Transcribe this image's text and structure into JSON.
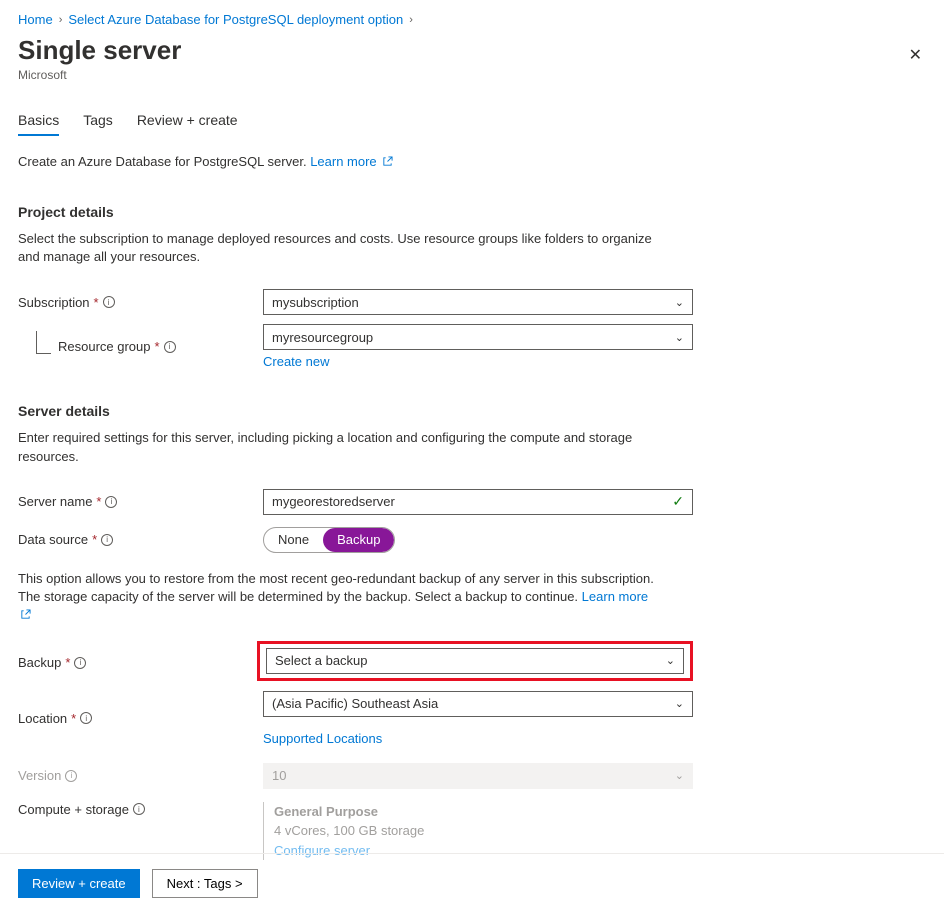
{
  "breadcrumb": {
    "home": "Home",
    "parent": "Select Azure Database for PostgreSQL deployment option"
  },
  "title": "Single server",
  "subtitle": "Microsoft",
  "tabs": {
    "basics": "Basics",
    "tags": "Tags",
    "review": "Review + create"
  },
  "intro": {
    "text": "Create an Azure Database for PostgreSQL server.",
    "learn": "Learn more"
  },
  "project": {
    "heading": "Project details",
    "desc": "Select the subscription to manage deployed resources and costs. Use resource groups like folders to organize and manage all your resources.",
    "subscription_label": "Subscription",
    "subscription_value": "mysubscription",
    "rg_label": "Resource group",
    "rg_value": "myresourcegroup",
    "create_new": "Create new"
  },
  "server": {
    "heading": "Server details",
    "desc": "Enter required settings for this server, including picking a location and configuring the compute and storage resources.",
    "name_label": "Server name",
    "name_value": "mygeorestoredserver",
    "ds_label": "Data source",
    "ds_none": "None",
    "ds_backup": "Backup",
    "restore_desc": "This option allows you to restore from the most recent geo-redundant backup of any server in this subscription. The storage capacity of the server will be determined by the backup. Select a backup to continue.",
    "learn": "Learn more",
    "backup_label": "Backup",
    "backup_value": "Select a backup",
    "location_label": "Location",
    "location_value": "(Asia Pacific) Southeast Asia",
    "supported": "Supported Locations",
    "version_label": "Version",
    "version_value": "10",
    "compute_label": "Compute + storage",
    "compute_tier": "General Purpose",
    "compute_spec": "4 vCores, 100 GB storage",
    "configure": "Configure server"
  },
  "footer": {
    "review": "Review + create",
    "next": "Next : Tags >"
  }
}
